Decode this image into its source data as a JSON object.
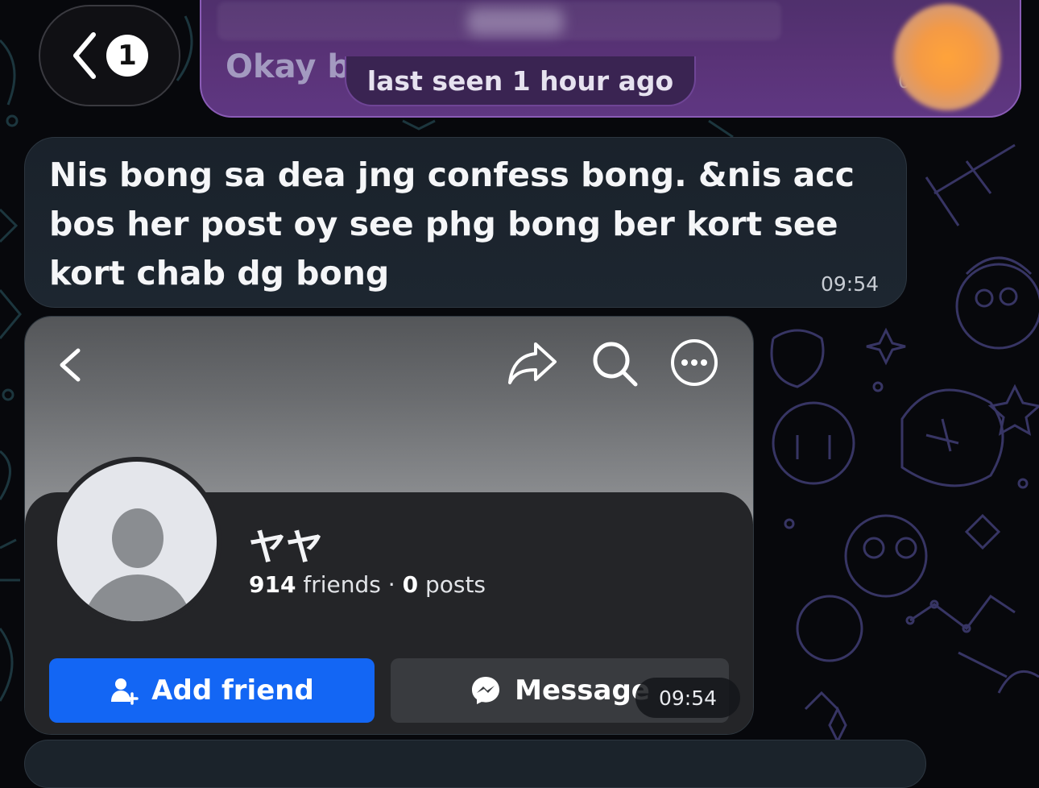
{
  "chat": {
    "unread_count": "1",
    "reply_preview_text": "Okay b",
    "status": "last seen 1 hour ago",
    "reply_tail": "0",
    "ticks": "//"
  },
  "message": {
    "text": "Nis bong sa dea jng confess bong. &nis acc bos her post oy see phg bong ber kort see kort chab dg bong",
    "time": "09:54"
  },
  "profile_screenshot": {
    "name": "ヤヤ",
    "friends_count": "914",
    "friends_label": "friends",
    "separator": "·",
    "posts_count": "0",
    "posts_label": "posts",
    "add_friend_label": "Add friend",
    "message_label": "Message",
    "time": "09:54"
  },
  "icons": {
    "back": "chevron-left-icon",
    "share": "share-icon",
    "search": "search-icon",
    "more": "more-icon",
    "add_friend": "add-person-icon",
    "messenger": "messenger-icon"
  },
  "colors": {
    "accent_purple": "#5a3378",
    "fb_blue": "#1366f4",
    "bubble_dark": "#1d2630"
  }
}
